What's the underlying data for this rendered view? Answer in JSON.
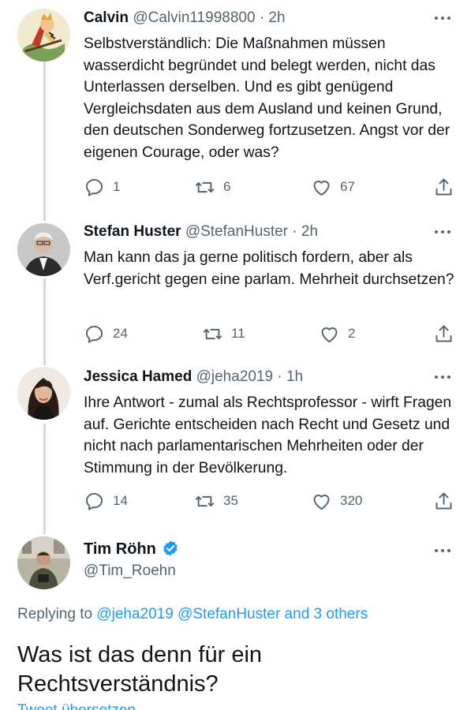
{
  "tweets": [
    {
      "name": "Calvin",
      "handle": "@Calvin11998800",
      "time": "· 2h",
      "text": "Selbstverständlich: Die Maßnahmen müssen wasserdicht begründet und belegt werden, nicht das Unterlassen derselben. Und es gibt genügend Vergleichsdaten aus dem Ausland und keinen Grund, den deutschen Sonderweg fortzusetzen. Angst vor der eigenen Courage, oder was?",
      "replies": "1",
      "retweets": "6",
      "likes": "67"
    },
    {
      "name": "Stefan Huster",
      "handle": "@StefanHuster",
      "time": "· 2h",
      "text": "Man kann das ja gerne politisch fordern, aber als Verf.gericht gegen eine parlam. Mehrheit durchsetzen?",
      "replies": "24",
      "retweets": "11",
      "likes": "2"
    },
    {
      "name": "Jessica Hamed",
      "handle": "@jeha2019",
      "time": "· 1h",
      "text": "Ihre Antwort - zumal als Rechtsprofessor - wirft Fragen auf. Gerichte entscheiden nach Recht und Gesetz und nicht nach parlamentarischen Mehrheiten oder der Stimmung in der Bevölkerung.",
      "replies": "14",
      "retweets": "35",
      "likes": "320"
    }
  ],
  "main_tweet": {
    "name": "Tim Röhn",
    "handle": "@Tim_Roehn",
    "replying_prefix": "Replying to",
    "replying_to": "@jeha2019 @StefanHuster and 3 others",
    "text": "Was ist das denn für ein Rechtsverständnis?",
    "cutoff_text": "Tweet übersetzen"
  },
  "colors": {
    "text": "#0f1419",
    "secondary": "#536471",
    "link": "#1d9bf0",
    "thread_line": "#cfd9de",
    "verified": "#1d9bf0"
  },
  "icons": [
    "reply-icon",
    "retweet-icon",
    "like-icon",
    "share-icon",
    "more-icon",
    "verified-badge-icon"
  ]
}
